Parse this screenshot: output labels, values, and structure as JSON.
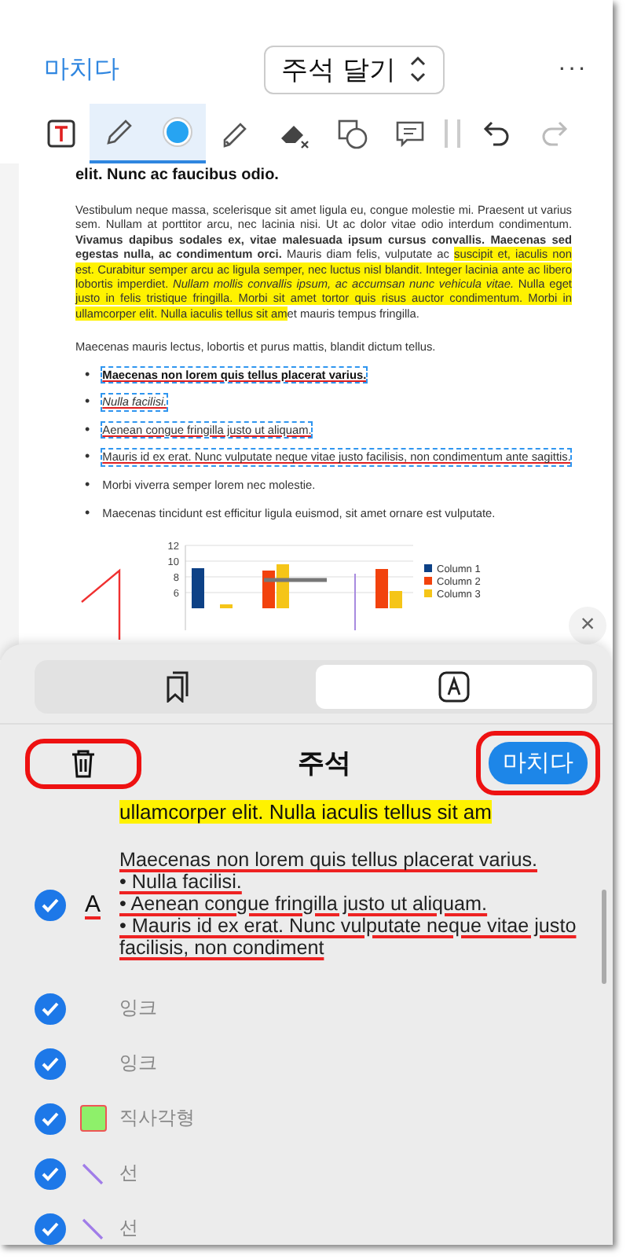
{
  "header": {
    "done_label": "마치다",
    "mode_label": "주석 달기",
    "more_label": "···"
  },
  "toolbar": {
    "tools": [
      {
        "kind": "text-box",
        "selected": false
      },
      {
        "kind": "pencil",
        "selected": true
      },
      {
        "kind": "color",
        "selected": true,
        "color": "#27a4f2"
      },
      {
        "kind": "highlighter",
        "selected": false
      },
      {
        "kind": "eraser",
        "selected": false
      },
      {
        "kind": "shapes",
        "selected": false
      },
      {
        "kind": "comment",
        "selected": false
      }
    ],
    "history": [
      {
        "kind": "undo",
        "disabled": false
      },
      {
        "kind": "redo",
        "disabled": true
      }
    ]
  },
  "document": {
    "heading": "elit. Nunc ac faucibus odio.",
    "paragraph_1": [
      {
        "text": "Vestibulum neque massa, scelerisque sit amet ligula eu, congue molestie mi. Praesent ut varius sem. Nullam at porttitor arcu, nec lacinia nisi. Ut ac dolor vitae odio interdum condimentum. **Vivamus dapibus sodales ex, vitae malesuada ipsum cursus convallis. Maecenas sed egestas nulla, ac condimentum orci.** Mauris diam felis, vulputate ac ",
        "highlighted": false
      },
      {
        "text": "suscipit et, iaculis non est. Curabitur semper arcu ac ligula semper, nec luctus nisl blandit. Integer lacinia ante ac libero lobortis imperdiet. *Nullam mollis convallis ipsum, ac accumsan nunc vehicula vitae.* Nulla eget justo in felis tristique fringilla. Morbi sit amet tortor quis risus auctor condimentum. Morbi in ullamcorper elit. Nulla iaculis tellus sit am",
        "highlighted": true
      },
      {
        "text": "et mauris tempus fringilla.",
        "highlighted": false
      }
    ],
    "paragraph_2": "Maecenas mauris lectus, lobortis et purus mattis, blandit dictum tellus.",
    "bullets": [
      {
        "marker": "•",
        "text": "Maecenas non lorem quis tellus placerat varius.",
        "kind": "bold",
        "selected": true
      },
      {
        "marker": "•",
        "text": "Nulla facilisi.",
        "kind": "italic",
        "selected": true
      },
      {
        "marker": "•",
        "text": "Aenean congue fringilla justo ut aliquam.",
        "kind": "plain",
        "selected": true
      },
      {
        "marker": "•",
        "text": "Mauris id ex erat. Nunc vulputate neque vitae justo facilisis, non condimentum ante sagittis.",
        "kind": "plain",
        "selected": true
      },
      {
        "marker": "•",
        "text": "Morbi viverra semper lorem nec molestie.",
        "kind": "plain",
        "selected": false
      },
      {
        "marker": "•",
        "text": "Maecenas tincidunt est efficitur ligula euismod, sit amet ornare est vulputate.",
        "kind": "plain",
        "selected": false
      }
    ],
    "chart_data": {
      "type": "bar",
      "ylim": [
        4,
        12
      ],
      "yticks": [
        6,
        8,
        10,
        12
      ],
      "grid": true,
      "legend": true,
      "series": [
        {
          "name": "Column 1",
          "color": "#0d4186",
          "values": [
            9.1,
            null,
            null,
            null
          ]
        },
        {
          "name": "Column 2",
          "color": "#f2420d",
          "values": [
            null,
            8.8,
            null,
            9.0
          ]
        },
        {
          "name": "Column 3",
          "color": "#f5c518",
          "values": [
            4.5,
            9.6,
            null,
            6.2
          ]
        }
      ]
    }
  },
  "close_label": "×",
  "sheet": {
    "tabs": [
      {
        "kind": "bookmarks",
        "selected": false
      },
      {
        "kind": "annotations",
        "selected": true
      }
    ],
    "title": "주석",
    "done_label": "마치다",
    "cut_item_text": "ullamcorper elit. Nulla iaculis tellus sit am",
    "annotations": [
      {
        "kind": "text-markup",
        "checked": true,
        "icon_label": "A",
        "lines": [
          "Maecenas non lorem quis tellus placerat varius.",
          "• Nulla facilisi.",
          "• Aenean congue fringilla justo ut aliquam.",
          "• Mauris id ex erat. Nunc vulputate neque vitae justo facilisis, non condiment"
        ]
      },
      {
        "kind": "ink",
        "checked": true,
        "label": "잉크"
      },
      {
        "kind": "ink",
        "checked": true,
        "label": "잉크"
      },
      {
        "kind": "rectangle",
        "checked": true,
        "label": "직사각형",
        "color": "#8ef06a"
      },
      {
        "kind": "line",
        "checked": true,
        "label": "선",
        "color": "#a07ce8"
      },
      {
        "kind": "line",
        "checked": true,
        "label": "선",
        "color": "#a07ce8"
      }
    ]
  }
}
